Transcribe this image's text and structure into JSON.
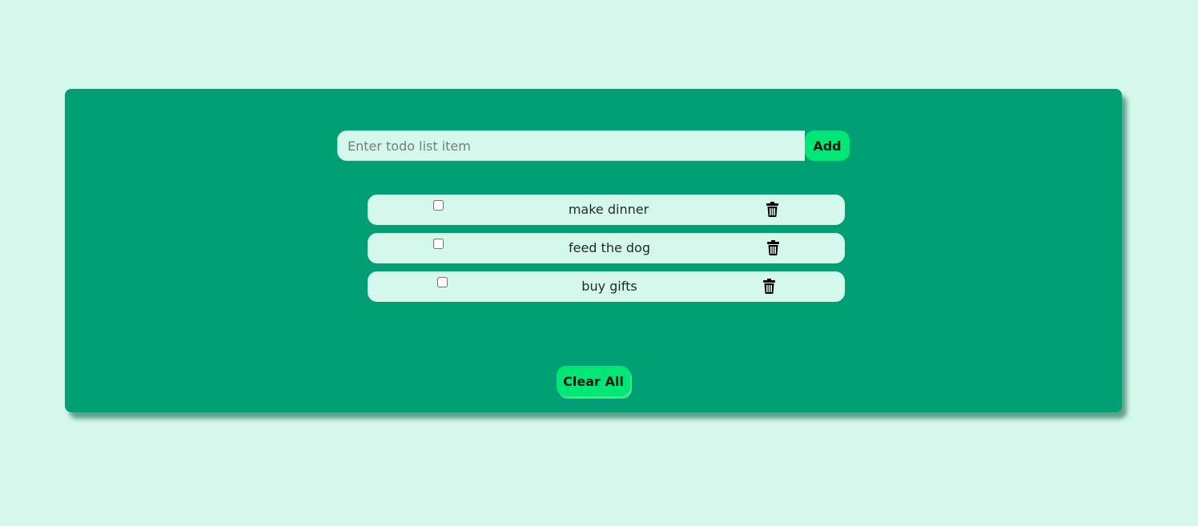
{
  "input": {
    "placeholder": "Enter todo list item",
    "value": ""
  },
  "add_button_label": "Add",
  "todos": [
    {
      "text": "make dinner",
      "checked": false
    },
    {
      "text": "feed the dog",
      "checked": false
    },
    {
      "text": "buy gifts",
      "checked": false
    }
  ],
  "clear_button_label": "Clear All",
  "icons": {
    "delete": "trash-icon"
  },
  "colors": {
    "page_background": "#d5f8ec",
    "card_background": "#00a074",
    "accent_button": "#00e777",
    "item_background": "#d5f8ec"
  }
}
